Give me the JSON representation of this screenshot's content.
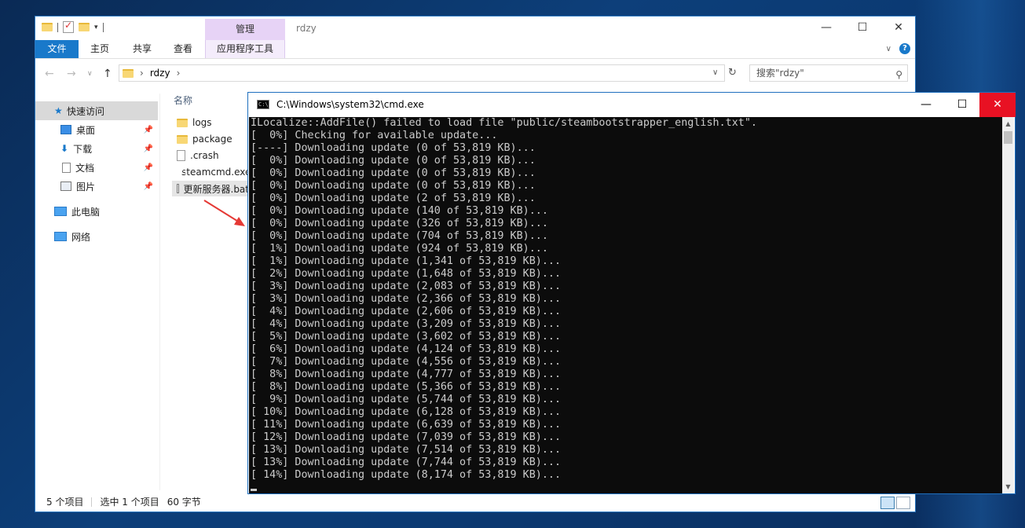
{
  "explorer": {
    "manage_tab": "管理",
    "window_title": "rdzy",
    "ribbon_tabs": [
      "文件",
      "主页",
      "共享",
      "查看",
      "应用程序工具"
    ],
    "breadcrumb_folder": "rdzy",
    "search_placeholder": "搜索\"rdzy\"",
    "nav_items": [
      "快速访问",
      "桌面",
      "下载",
      "文档",
      "图片",
      "此电脑",
      "网络"
    ],
    "column_header": "名称",
    "files": [
      "logs",
      "package",
      ".crash",
      "steamcmd.exe",
      "更新服务器.bat"
    ],
    "status": {
      "count": "5 个项目",
      "selected": "选中 1 个项目",
      "size": "60 字节"
    }
  },
  "cmd": {
    "title": "C:\\Windows\\system32\\cmd.exe",
    "icon_text": "C:\\",
    "lines": [
      "ILocalize::AddFile() failed to load file \"public/steambootstrapper_english.txt\".",
      "[  0%] Checking for available update...",
      "[----] Downloading update (0 of 53,819 KB)...",
      "[  0%] Downloading update (0 of 53,819 KB)...",
      "[  0%] Downloading update (0 of 53,819 KB)...",
      "[  0%] Downloading update (0 of 53,819 KB)...",
      "[  0%] Downloading update (2 of 53,819 KB)...",
      "[  0%] Downloading update (140 of 53,819 KB)...",
      "[  0%] Downloading update (326 of 53,819 KB)...",
      "[  0%] Downloading update (704 of 53,819 KB)...",
      "[  1%] Downloading update (924 of 53,819 KB)...",
      "[  1%] Downloading update (1,341 of 53,819 KB)...",
      "[  2%] Downloading update (1,648 of 53,819 KB)...",
      "[  3%] Downloading update (2,083 of 53,819 KB)...",
      "[  3%] Downloading update (2,366 of 53,819 KB)...",
      "[  4%] Downloading update (2,606 of 53,819 KB)...",
      "[  4%] Downloading update (3,209 of 53,819 KB)...",
      "[  5%] Downloading update (3,602 of 53,819 KB)...",
      "[  6%] Downloading update (4,124 of 53,819 KB)...",
      "[  7%] Downloading update (4,556 of 53,819 KB)...",
      "[  8%] Downloading update (4,777 of 53,819 KB)...",
      "[  8%] Downloading update (5,366 of 53,819 KB)...",
      "[  9%] Downloading update (5,744 of 53,819 KB)...",
      "[ 10%] Downloading update (6,128 of 53,819 KB)...",
      "[ 11%] Downloading update (6,639 of 53,819 KB)...",
      "[ 12%] Downloading update (7,039 of 53,819 KB)...",
      "[ 13%] Downloading update (7,514 of 53,819 KB)...",
      "[ 13%] Downloading update (7,744 of 53,819 KB)...",
      "[ 14%] Downloading update (8,174 of 53,819 KB)..."
    ]
  },
  "colors": {
    "accent": "#1979ca",
    "manage_tab": "#e7d3f6",
    "console_bg": "#0c0c0c",
    "console_fg": "#cccccc",
    "close_red": "#e81123",
    "annotation_arrow": "#e53935"
  }
}
